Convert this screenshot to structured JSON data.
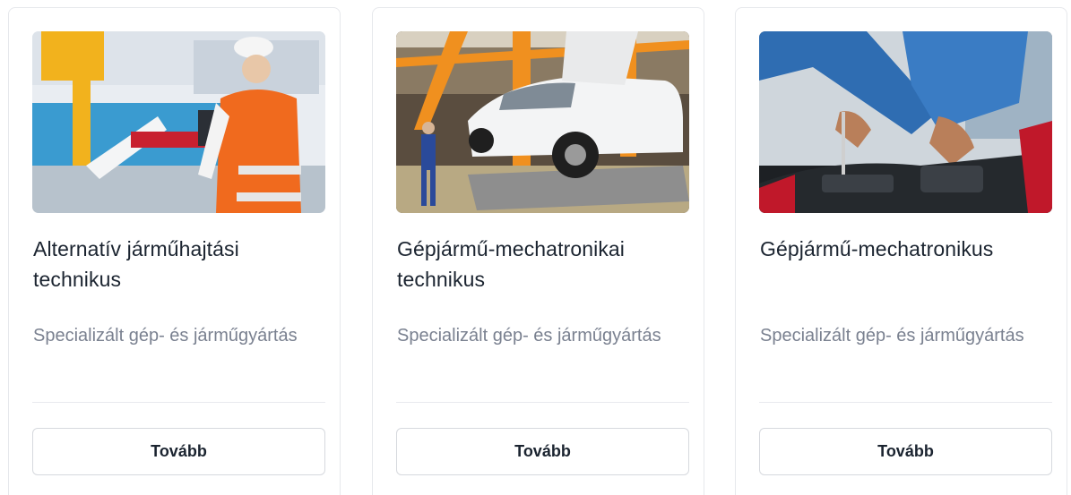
{
  "cards": [
    {
      "title": "Alternatív járműhajtási technikus",
      "subtitle": "Specializált gép- és járműgyártás",
      "button_label": "Tovább",
      "image_subject": "engineer-with-robot-arm"
    },
    {
      "title": "Gépjármű-mechatronikai technikus",
      "subtitle": "Specializált gép- és járműgyártás",
      "button_label": "Tovább",
      "image_subject": "car-assembly-line"
    },
    {
      "title": "Gépjármű-mechatronikus",
      "subtitle": "Specializált gép- és járműgyártás",
      "button_label": "Tovább",
      "image_subject": "mechanic-working-on-engine"
    }
  ],
  "colors": {
    "card_border": "#e6e8ec",
    "title": "#1b2430",
    "subtitle": "#7a8190",
    "button_border": "#d6d9de"
  }
}
